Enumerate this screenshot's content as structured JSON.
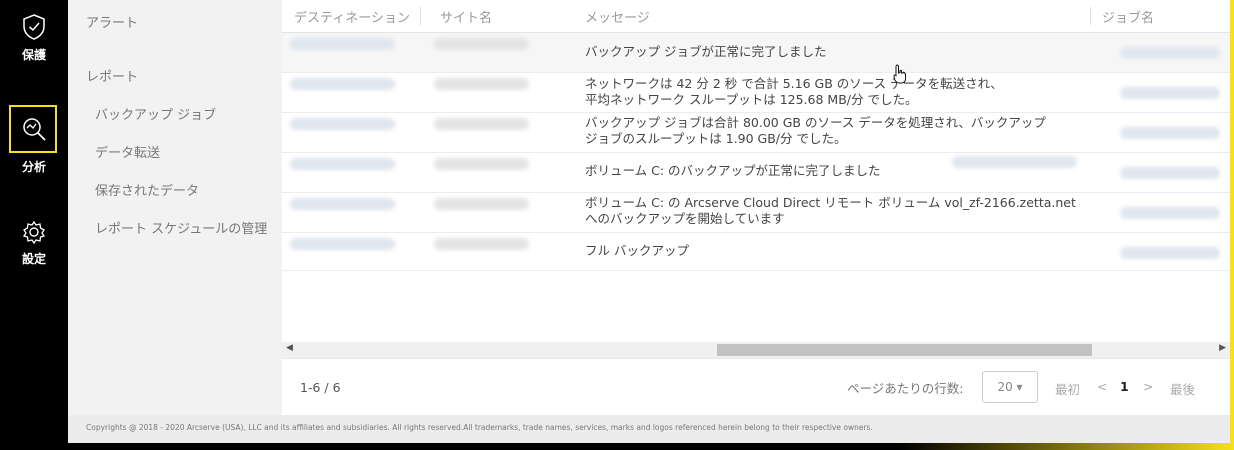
{
  "nav": {
    "items": [
      {
        "icon": "shield-icon",
        "label": "保護"
      },
      {
        "icon": "search-analytics-icon",
        "label": "分析"
      },
      {
        "icon": "gear-icon",
        "label": "設定"
      }
    ]
  },
  "subnav": {
    "alerts": "アラート",
    "reports": "レポート",
    "backup_jobs": "バックアップ ジョブ",
    "data_transfer": "データ転送",
    "stored_data": "保存されたデータ",
    "report_schedule": "レポート スケジュールの管理"
  },
  "table": {
    "headers": {
      "destination": "デスティネーション",
      "site_name": "サイト名",
      "message": "メッセージ",
      "job_name": "ジョブ名"
    },
    "rows": [
      {
        "message": [
          "バックアップ ジョブが正常に完了しました"
        ]
      },
      {
        "message": [
          "ネットワークは 42 分 2 秒 で合計 5.16 GB のソース データを転送され、",
          "平均ネットワーク スループットは 125.68 MB/分 でした。"
        ]
      },
      {
        "message": [
          "バックアップ ジョブは合計 80.00 GB のソース データを処理され、バックアップ",
          "ジョブのスループットは 1.90 GB/分 でした。"
        ]
      },
      {
        "message": [
          "ボリューム C: のバックアップが正常に完了しました"
        ]
      },
      {
        "message": [
          "ボリューム C: の Arcserve Cloud Direct リモート ボリューム vol_zf-2166.zetta.net",
          "へのバックアップを開始しています"
        ]
      },
      {
        "message": [
          "フル バックアップ"
        ]
      }
    ]
  },
  "pager": {
    "range": "1-6 / 6",
    "rows_per_page_label": "ページあたりの行数:",
    "rows_per_page_value": "20 ▾",
    "first": "最初",
    "prev": "<",
    "current_page": "1",
    "next": ">",
    "last": "最後"
  },
  "footer": {
    "copyright": "Copyrights @ 2018 - 2020 Arcserve (USA), LLC and its affiliates and subsidiaries. All rights reserved.All trademarks, trade names, services, marks and logos referenced herein belong to their respective owners."
  },
  "colors": {
    "accent": "#f7e11b",
    "nav_bg": "#000000"
  }
}
